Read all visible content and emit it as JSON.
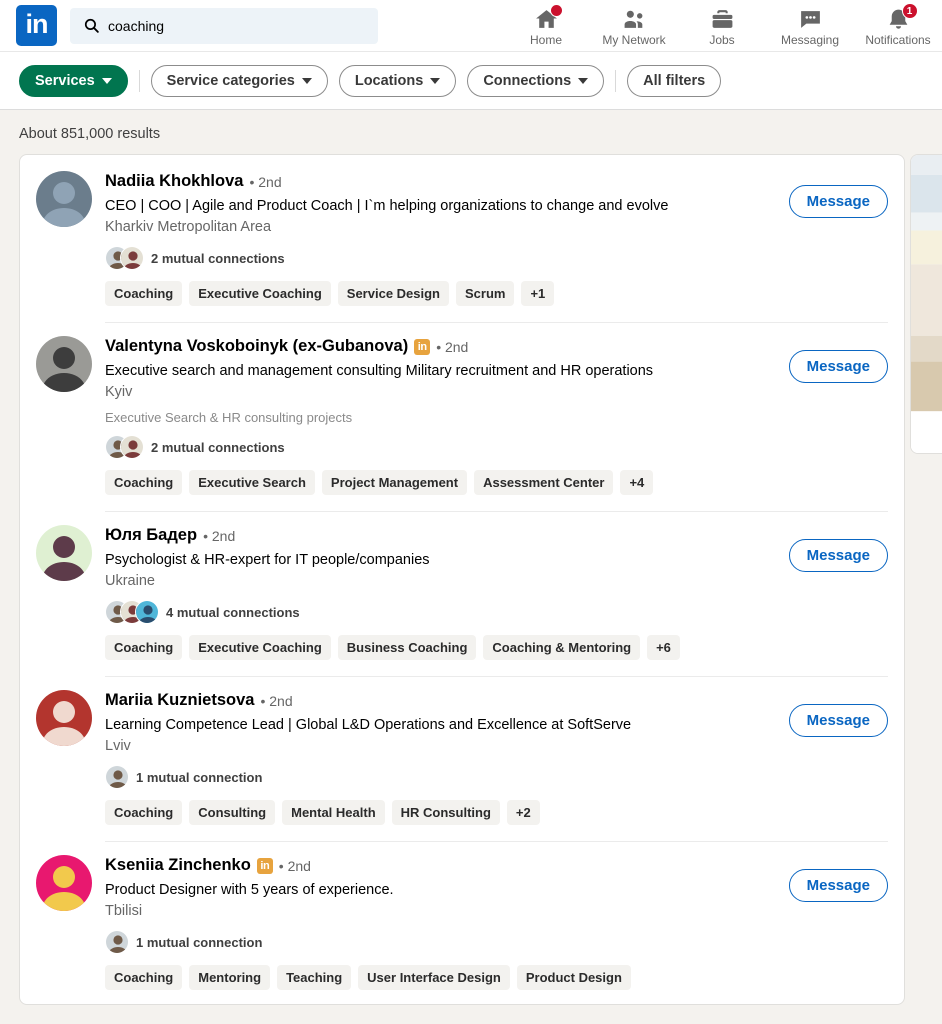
{
  "header": {
    "logo_label": "in",
    "search": {
      "value": "coaching",
      "placeholder": "Search",
      "icon": "search-icon"
    },
    "nav": [
      {
        "label": "Home",
        "icon": "home-icon",
        "badge": ""
      },
      {
        "label": "My Network",
        "icon": "people-icon",
        "badge": ""
      },
      {
        "label": "Jobs",
        "icon": "briefcase-icon",
        "badge": ""
      },
      {
        "label": "Messaging",
        "icon": "message-bubble-icon",
        "badge": ""
      },
      {
        "label": "Notifications",
        "icon": "bell-icon",
        "badge": "1"
      }
    ]
  },
  "filters": {
    "primary": {
      "label": "Services",
      "active": true
    },
    "items": [
      {
        "label": "Service categories",
        "has_caret": true
      },
      {
        "label": "Locations",
        "has_caret": true
      },
      {
        "label": "Connections",
        "has_caret": true
      }
    ],
    "all_filters_label": "All filters"
  },
  "results_count": "About 851,000 results",
  "message_button_label": "Message",
  "colors": {
    "brand_blue": "#0a66c2",
    "services_green": "#01754f",
    "premium_gold": "#e7a33e",
    "notification_red": "#cb112d",
    "page_background": "#f4f2ee"
  },
  "results": [
    {
      "name": "Nadiia Khokhlova",
      "premium": false,
      "degree": "• 2nd",
      "headline": "CEO | COO | Agile and Product Coach | I`m helping organizations to change and evolve",
      "location": "Kharkiv Metropolitan Area",
      "extra": "",
      "mutual_text": "2 mutual connections",
      "mutual_faces": 2,
      "tags": [
        "Coaching",
        "Executive Coaching",
        "Service Design",
        "Scrum",
        "+1"
      ],
      "avatar_colors": [
        "#6b7d8c",
        "#8fa3b5"
      ]
    },
    {
      "name": "Valentyna Voskoboinyk (ex-Gubanova)",
      "premium": true,
      "degree": "• 2nd",
      "headline": "Executive search and management consulting Military recruitment and HR operations",
      "location": "Kyiv",
      "extra": "Executive Search & HR consulting projects",
      "mutual_text": "2 mutual connections",
      "mutual_faces": 2,
      "tags": [
        "Coaching",
        "Executive Search",
        "Project Management",
        "Assessment Center",
        "+4"
      ],
      "avatar_colors": [
        "#9a9a96",
        "#3d3d3d"
      ]
    },
    {
      "name": "Юля Бадер",
      "premium": false,
      "degree": "• 2nd",
      "headline": "Psychologist & HR-expert for IT people/companies",
      "location": "Ukraine",
      "extra": "",
      "mutual_text": "4 mutual connections",
      "mutual_faces": 3,
      "tags": [
        "Coaching",
        "Executive Coaching",
        "Business Coaching",
        "Coaching & Mentoring",
        "+6"
      ],
      "avatar_colors": [
        "#dff0d2",
        "#5d3b4a"
      ]
    },
    {
      "name": "Mariia Kuznietsova",
      "premium": false,
      "degree": "• 2nd",
      "headline": "Learning Competence Lead | Global L&D Operations and Excellence at SoftServe",
      "location": "Lviv",
      "extra": "",
      "mutual_text": "1 mutual connection",
      "mutual_faces": 1,
      "tags": [
        "Coaching",
        "Consulting",
        "Mental Health",
        "HR Consulting",
        "+2"
      ],
      "avatar_colors": [
        "#b3352e",
        "#f0d9cf"
      ]
    },
    {
      "name": "Kseniia Zinchenko",
      "premium": true,
      "degree": "• 2nd",
      "headline": "Product Designer with 5 years of experience.",
      "location": "Tbilisi",
      "extra": "",
      "mutual_text": "1 mutual connection",
      "mutual_faces": 1,
      "tags": [
        "Coaching",
        "Mentoring",
        "Teaching",
        "User Interface Design",
        "Product Design"
      ],
      "avatar_colors": [
        "#e8186f",
        "#f2c94c"
      ]
    }
  ]
}
